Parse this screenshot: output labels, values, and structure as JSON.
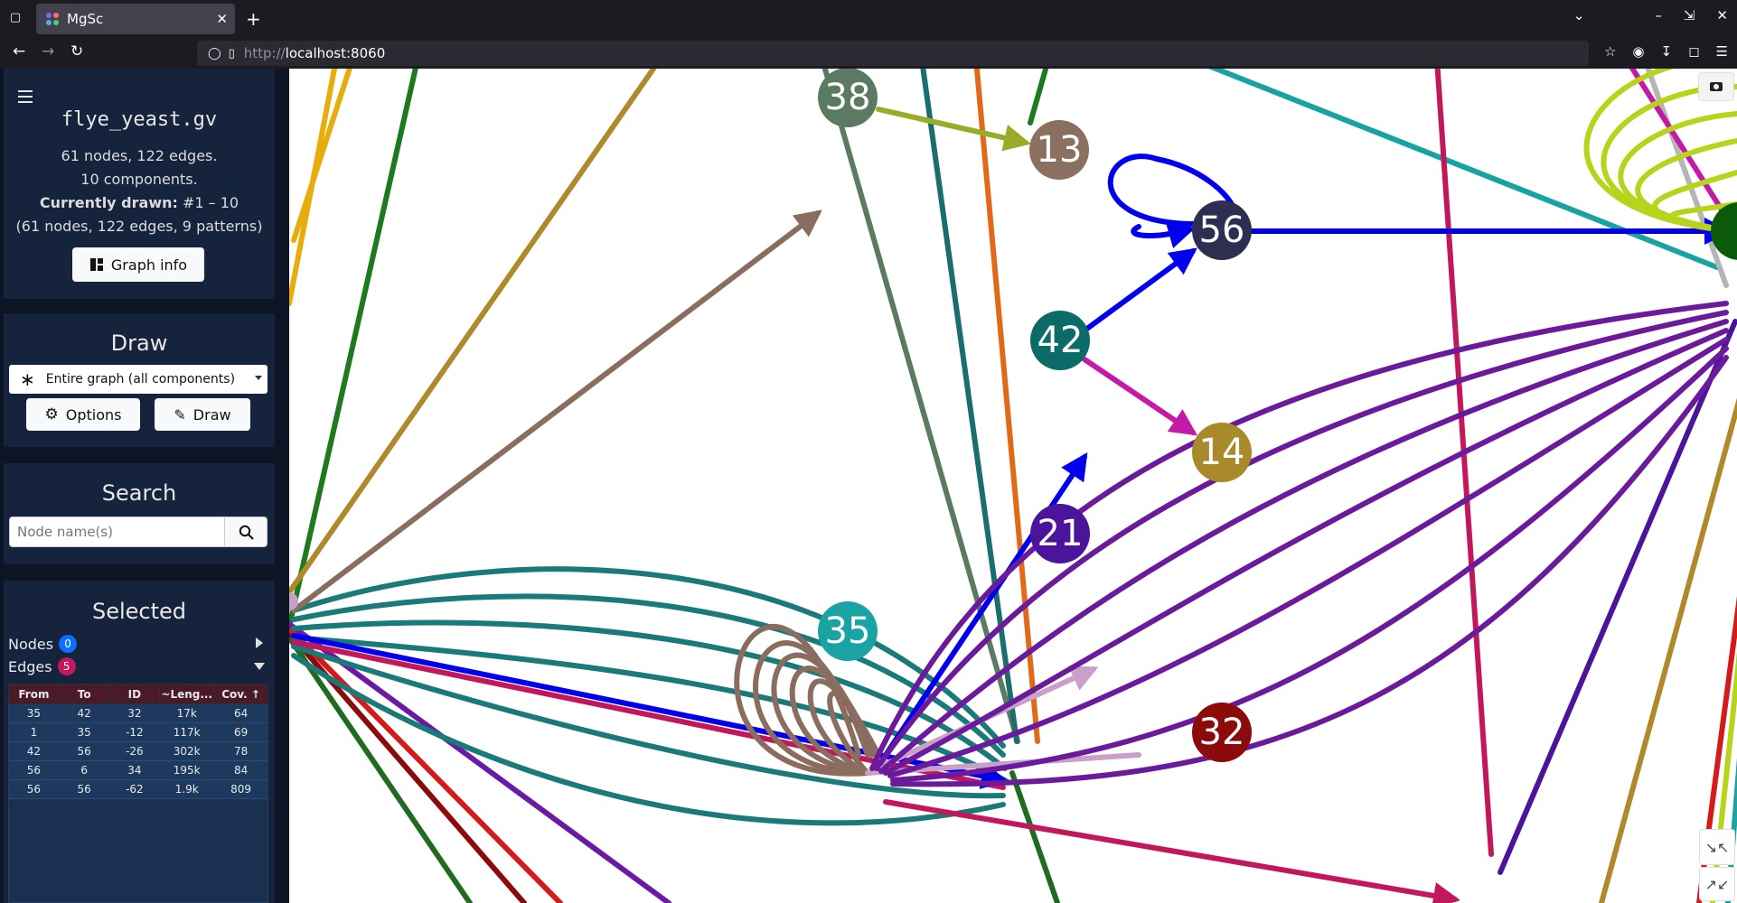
{
  "browser": {
    "tab_title": "MgSc",
    "url_protocol": "http://",
    "url_host": "localhost:8060"
  },
  "sidebar": {
    "filename": "flye_yeast.gv",
    "stats_line": "61 nodes, 122 edges.",
    "components_line": "10 components.",
    "drawn_label": "Currently drawn:",
    "drawn_value": "#1 – 10",
    "drawn_detail": "(61 nodes, 122 edges, 9 patterns)",
    "graph_info_button": "Graph info",
    "draw_title": "Draw",
    "draw_select_value": "Entire graph (all components)",
    "options_button": "Options",
    "draw_button": "Draw",
    "search_title": "Search",
    "search_placeholder": "Node name(s)",
    "selected_title": "Selected",
    "nodes_label": "Nodes",
    "nodes_count": "0",
    "edges_label": "Edges",
    "edges_count": "5",
    "table": {
      "headers": [
        "From",
        "To",
        "ID",
        "~Leng...",
        "Cov. ↑"
      ],
      "rows": [
        [
          "35",
          "42",
          "32",
          "17k",
          "64"
        ],
        [
          "1",
          "35",
          "-12",
          "117k",
          "69"
        ],
        [
          "42",
          "56",
          "-26",
          "302k",
          "78"
        ],
        [
          "56",
          "6",
          "34",
          "195k",
          "84"
        ],
        [
          "56",
          "56",
          "-62",
          "1.9k",
          "809"
        ]
      ]
    }
  },
  "graph": {
    "nodes": [
      {
        "id": "38",
        "color": "#5b7a62"
      },
      {
        "id": "13",
        "color": "#8b7060"
      },
      {
        "id": "56",
        "color": "#2e2e50"
      },
      {
        "id": "42",
        "color": "#0b6b69"
      },
      {
        "id": "14",
        "color": "#a88a2a"
      },
      {
        "id": "21",
        "color": "#4b149a"
      },
      {
        "id": "35",
        "color": "#1aa3a3"
      },
      {
        "id": "32",
        "color": "#8b0a0a"
      }
    ]
  }
}
